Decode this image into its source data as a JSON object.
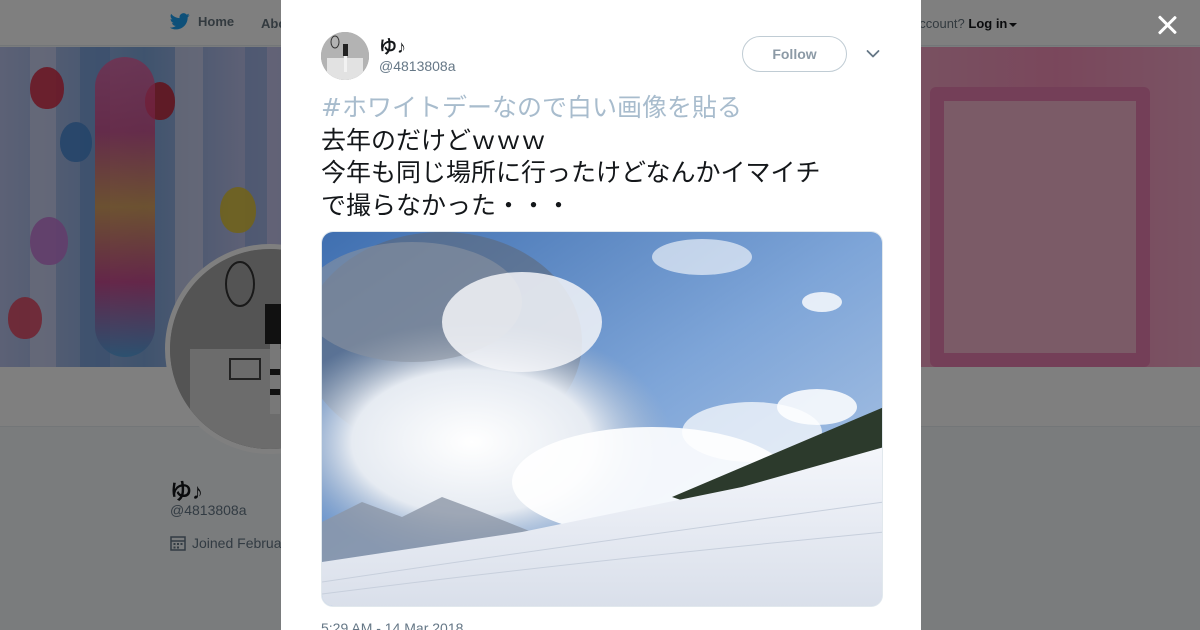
{
  "nav": {
    "home_label": "Home",
    "about_label": "Abo",
    "account_prefix": "account?",
    "login_label": "Log in"
  },
  "profile": {
    "name": "ゆ♪",
    "handle": "@4813808a",
    "joined": "Joined Februa"
  },
  "tweet": {
    "author_name": "ゆ♪",
    "author_handle": "@4813808a",
    "follow_label": "Follow",
    "hashtag": "#ホワイトデーなので白い画像を貼る",
    "lines": [
      "去年のだけどｗｗｗ",
      "今年も同じ場所に行ったけどなんかイマイチ",
      "で撮らなかった・・・"
    ],
    "timestamp": "5:29 AM - 14 Mar 2018"
  },
  "colors": {
    "twitter_blue": "#1da1f2",
    "hashtag": "#a8bccd",
    "overlay": "rgba(0,0,0,0.5)"
  },
  "icons": [
    "twitter-bird-icon",
    "calendar-icon",
    "close-icon",
    "chevron-down-icon"
  ]
}
